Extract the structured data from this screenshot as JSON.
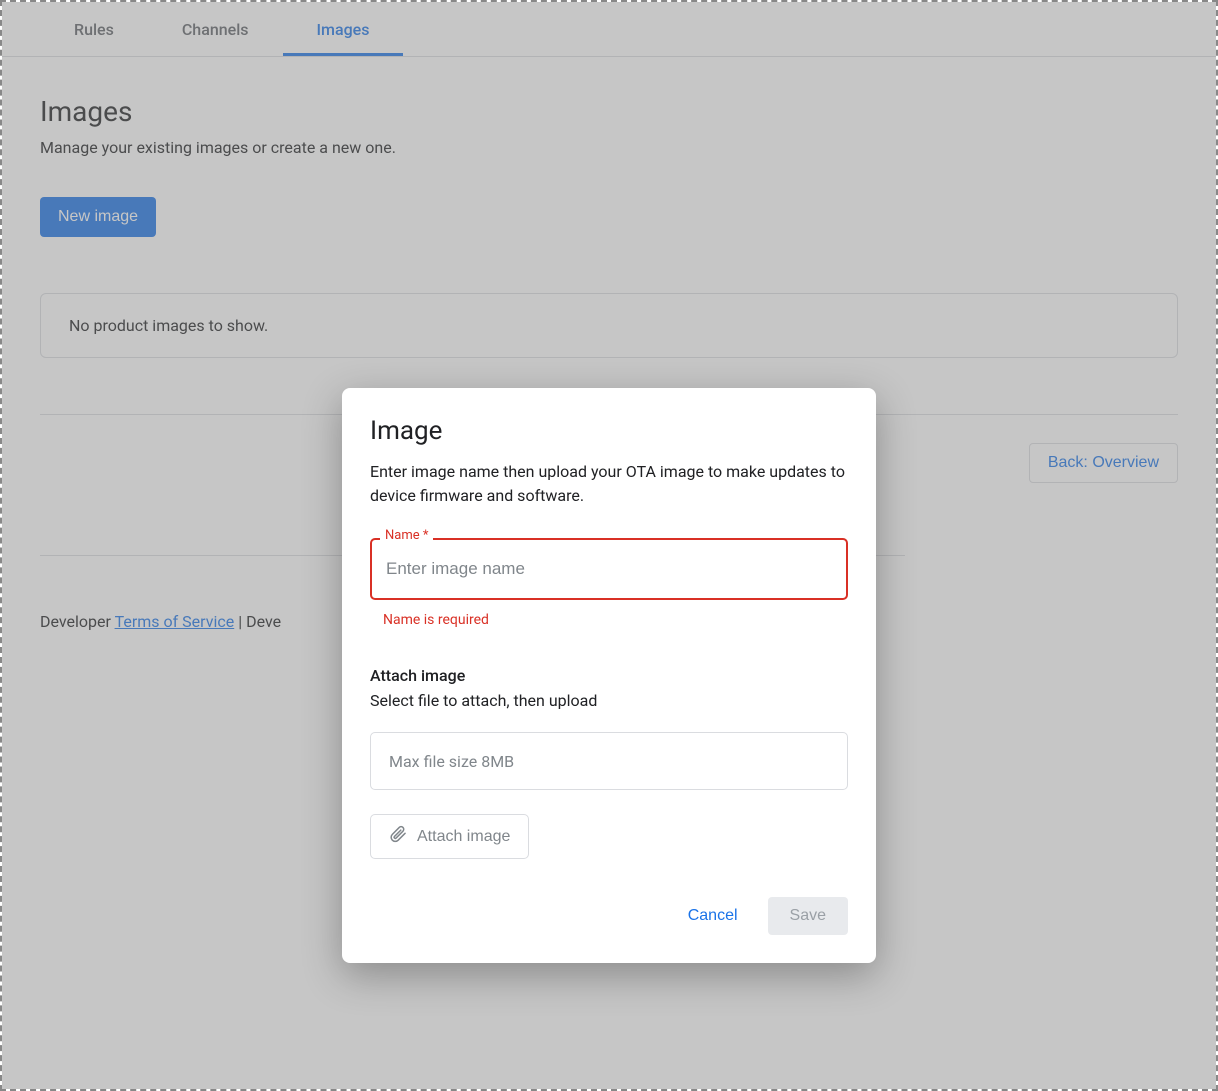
{
  "tabs": {
    "rules": "Rules",
    "channels": "Channels",
    "images": "Images"
  },
  "page": {
    "title": "Images",
    "subtitle": "Manage your existing images or create a new one.",
    "new_image_btn": "New image",
    "empty_message": "No product images to show.",
    "back_btn": "Back: Overview"
  },
  "footer": {
    "prefix": "Developer ",
    "tos": "Terms of Service",
    "sep": " | Deve"
  },
  "dialog": {
    "title": "Image",
    "description": "Enter image name then upload your OTA image to make updates to device firmware and software.",
    "name_label": "Name *",
    "name_placeholder": "Enter image name",
    "name_value": "",
    "name_error": "Name is required",
    "attach_title": "Attach image",
    "attach_subtitle": "Select file to attach, then upload",
    "file_placeholder": "Max file size 8MB",
    "attach_btn": "Attach image",
    "cancel": "Cancel",
    "save": "Save"
  }
}
